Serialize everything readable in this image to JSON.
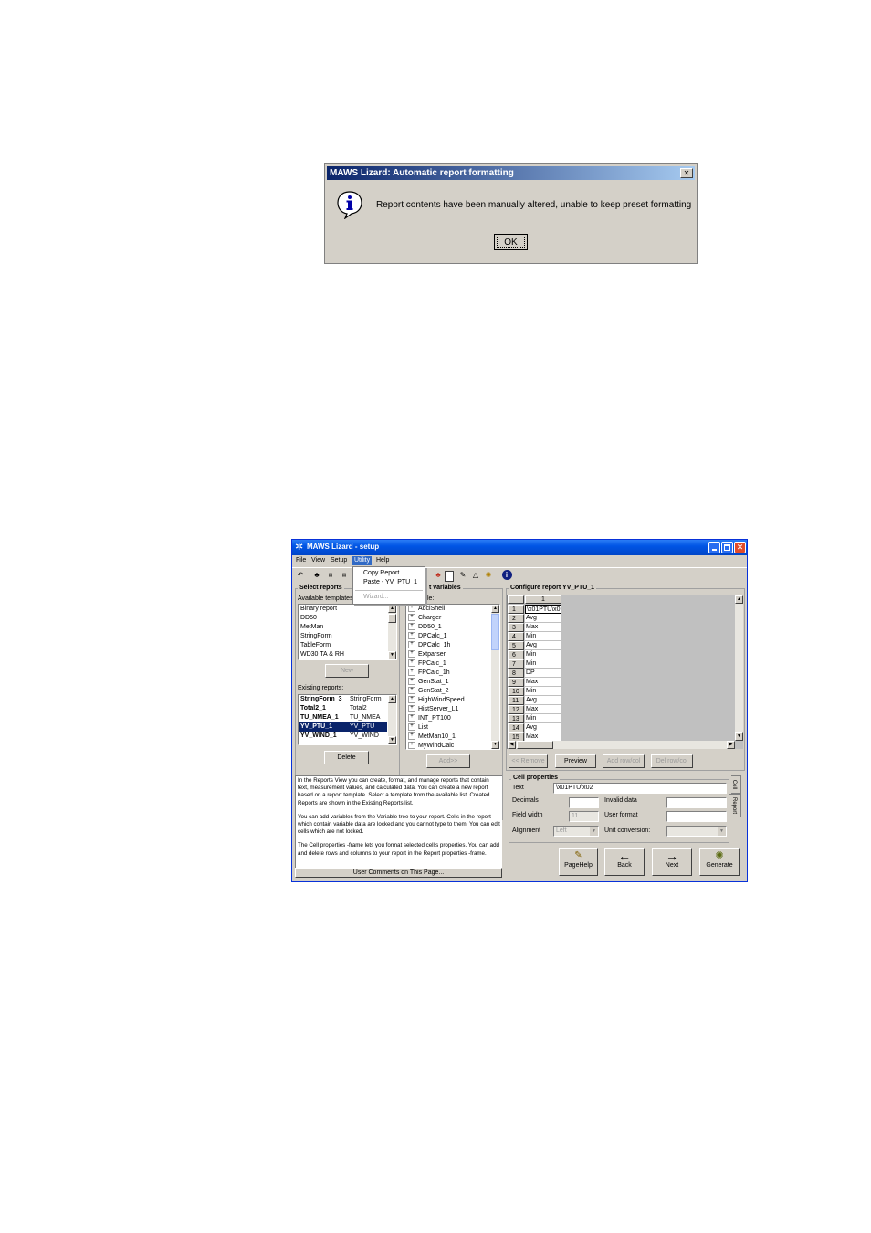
{
  "dialog": {
    "title": "MAWS Lizard: Automatic report formatting",
    "message": "Report contents have been manually altered, unable to keep preset formatting",
    "ok_label": "OK",
    "close_glyph": "✕"
  },
  "window": {
    "title": "MAWS Lizard - setup",
    "menu": [
      "File",
      "View",
      "Setup",
      "Utility",
      "Help"
    ],
    "utility_menu": [
      "Copy Report",
      "Paste - YV_PTU_1",
      "Wizard..."
    ]
  },
  "select_reports": {
    "title": "Select reports",
    "templates_label": "Available templates:",
    "templates": [
      "Binary report",
      "DD50",
      "MetMan",
      "StringForm",
      "TableForm",
      "WD30 TA & RH"
    ],
    "new_label": "New",
    "existing_label": "Existing reports:",
    "existing": [
      {
        "name": "StringForm_3",
        "template": "StringForm"
      },
      {
        "name": "Total2_1",
        "template": "Total2"
      },
      {
        "name": "TU_NMEA_1",
        "template": "TU_NMEA"
      },
      {
        "name": "YV_PTU_1",
        "template": "YV_PTU"
      },
      {
        "name": "YV_WIND_1",
        "template": "YV_WIND"
      }
    ],
    "delete_label": "Delete"
  },
  "variables": {
    "title": "t variables",
    "subtitle": "le:",
    "items": [
      "AdclShell",
      "Charger",
      "DD50_1",
      "DPCalc_1",
      "DPCalc_1h",
      "Extparser",
      "FPCalc_1",
      "FPCalc_1h",
      "GenStat_1",
      "GenStat_2",
      "HighWindSpeed",
      "HistServer_L1",
      "INT_PT100",
      "List",
      "MetMan10_1",
      "MyWindCalc"
    ],
    "expander": "+",
    "add_label": "Add>>"
  },
  "configure": {
    "title": "Configure report YV_PTU_1",
    "col_header": "1",
    "rows": [
      {
        "n": "1",
        "v": "\\x01PTU\\x0"
      },
      {
        "n": "2",
        "v": "Avg"
      },
      {
        "n": "3",
        "v": "Max"
      },
      {
        "n": "4",
        "v": "Min"
      },
      {
        "n": "5",
        "v": "Avg"
      },
      {
        "n": "6",
        "v": "Min"
      },
      {
        "n": "7",
        "v": "Min"
      },
      {
        "n": "8",
        "v": "DP"
      },
      {
        "n": "9",
        "v": "Max"
      },
      {
        "n": "10",
        "v": "Min"
      },
      {
        "n": "11",
        "v": "Avg"
      },
      {
        "n": "12",
        "v": "Max"
      },
      {
        "n": "13",
        "v": "Min"
      },
      {
        "n": "14",
        "v": "Avg"
      },
      {
        "n": "15",
        "v": "Max"
      }
    ],
    "buttons": {
      "remove": "<< Remove",
      "preview": "Preview",
      "add_rowcol": "Add row/col",
      "del_rowcol": "Del row/col"
    }
  },
  "help": {
    "p1": "In the Reports View you can create, format, and manage reports that contain text, measurement values, and calculated data. You can create a new report based on a report template. Select a template from the available list. Created Reports are shown in the Existing Reports list.",
    "p2": "You can add variables from the Variable tree to your report. Cells in the report which contain variable data are locked and you cannot type to them. You can edit cells which are not locked.",
    "p3": "The Cell properties -frame lets you format selected cell's properties. You can add and delete rows and columns to your report in the Report properties -frame.",
    "comments": "User Comments on This Page..."
  },
  "cell_props": {
    "title": "Cell properties",
    "text_label": "Text",
    "text_value": "\\x01PTU\\x02",
    "decimals_label": "Decimals",
    "invalid_label": "Invalid data",
    "field_width_label": "Field width",
    "field_width_value": "11",
    "user_format_label": "User format",
    "alignment_label": "Alignment",
    "alignment_value": "Left",
    "unit_conv_label": "Unit conversion:",
    "tab_cell": "Cell",
    "tab_report": "Report"
  },
  "nav": {
    "pagehelp": "PageHelp",
    "back": "Back",
    "next": "Next",
    "generate": "Generate"
  },
  "colors": {
    "titlebar": "#0a246a",
    "xp_titlebar": "#0055e5",
    "face": "#d4d0c8",
    "selection": "#0a246a",
    "grid_bg": "#c0c0c0"
  }
}
